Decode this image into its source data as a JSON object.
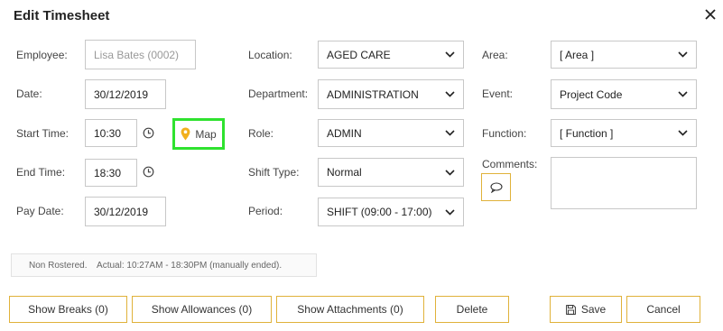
{
  "dialog": {
    "title": "Edit Timesheet"
  },
  "icons": {
    "close": "close-icon",
    "clock": "clock-icon",
    "map": "map-pin-icon",
    "chevron": "chevron-down-icon",
    "comment": "speech-bubble-icon",
    "save": "floppy-disk-icon"
  },
  "colors": {
    "accent_border": "#e0b23a",
    "highlight": "#2fe22f",
    "pin": "#f2b01e"
  },
  "left": {
    "employee_label": "Employee:",
    "employee_value": "Lisa Bates (0002)",
    "date_label": "Date:",
    "date_value": "30/12/2019",
    "start_label": "Start Time:",
    "start_value": "10:30",
    "map_label": "Map",
    "end_label": "End Time:",
    "end_value": "18:30",
    "paydate_label": "Pay Date:",
    "paydate_value": "30/12/2019"
  },
  "middle": {
    "location_label": "Location:",
    "location_value": "AGED CARE",
    "department_label": "Department:",
    "department_value": "ADMINISTRATION",
    "role_label": "Role:",
    "role_value": "ADMIN",
    "shifttype_label": "Shift Type:",
    "shifttype_value": "Normal",
    "period_label": "Period:",
    "period_value": "SHIFT (09:00 - 17:00)"
  },
  "right": {
    "area_label": "Area:",
    "area_value": "[ Area ]",
    "event_label": "Event:",
    "event_value": "Project Code",
    "function_label": "Function:",
    "function_value": "[ Function ]",
    "comments_label": "Comments:",
    "comments_value": ""
  },
  "status": {
    "text": "Non Rostered.    Actual: 10:27AM - 18:30PM (manually ended)."
  },
  "buttons": {
    "show_breaks": "Show Breaks (0)",
    "show_allowances": "Show Allowances (0)",
    "show_attachments": "Show Attachments (0)",
    "delete": "Delete",
    "save": "Save",
    "cancel": "Cancel"
  }
}
